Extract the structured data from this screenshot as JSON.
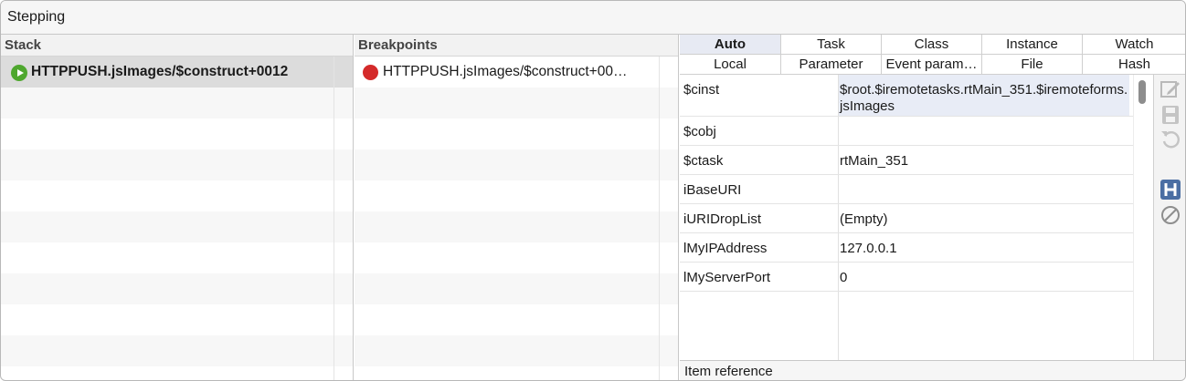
{
  "window": {
    "title": "Stepping"
  },
  "stack": {
    "header": "Stack",
    "items": [
      {
        "label": "HTTPPUSH.jsImages/$construct+0012",
        "icon": "play-icon"
      }
    ]
  },
  "breakpoints": {
    "header": "Breakpoints",
    "items": [
      {
        "label": "HTTPPUSH.jsImages/$construct+00…",
        "icon": "breakpoint-dot-icon"
      }
    ]
  },
  "variables": {
    "tabs_row1": [
      "Auto",
      "Task",
      "Class",
      "Instance",
      "Watch"
    ],
    "tabs_row2": [
      "Local",
      "Parameter",
      "Event param…",
      "File",
      "Hash"
    ],
    "active_tab": "Auto",
    "rows": [
      {
        "name": "$cinst",
        "value": "$root.$iremotetasks.rtMain_351.$iremoteforms.jsImages"
      },
      {
        "name": "$cobj",
        "value": ""
      },
      {
        "name": "$ctask",
        "value": "rtMain_351"
      },
      {
        "name": "iBaseURI",
        "value": ""
      },
      {
        "name": "iURIDropList",
        "value": "(Empty)"
      },
      {
        "name": "lMyIPAddress",
        "value": "127.0.0.1"
      },
      {
        "name": "lMyServerPort",
        "value": "0"
      }
    ],
    "status": "Item reference"
  },
  "toolbar_icons": [
    "edit-icon",
    "save-icon",
    "revert-icon",
    "hash-icon",
    "clear-icon"
  ],
  "colors": {
    "accent": "#e7eaf3",
    "play": "#4ea72e",
    "breakpoint": "#d42a2a"
  }
}
